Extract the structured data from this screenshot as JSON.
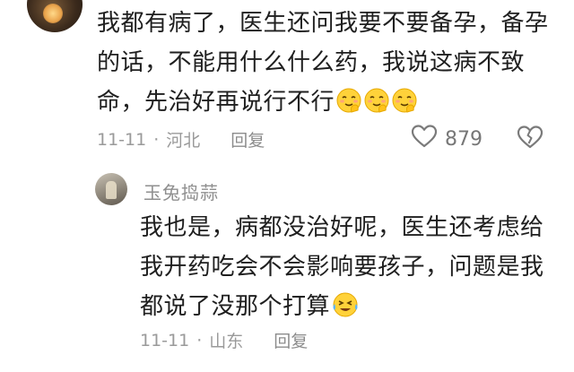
{
  "comment": {
    "text": "我都有病了，医生还问我要不要备孕，备孕的话，不能用什么什么药，我说这病不致命，先治好再说行不行",
    "emoji": [
      "smiling-face-with-hand",
      "smiling-face-with-hand",
      "smiling-face-with-hand"
    ],
    "date": "11-11",
    "separator": "·",
    "location": "河北",
    "reply_label": "回复",
    "like_count": "879"
  },
  "reply": {
    "username": "玉兔捣蒜",
    "text": "我也是，病都没治好呢，医生还考虑给我开药吃会不会影响要孩子，问题是我都说了没那个打算",
    "emoji": [
      "crying-smile-face"
    ],
    "date": "11-11",
    "separator": "·",
    "location": "山东",
    "reply_label": "回复"
  },
  "icons": {
    "like": "heart-outline-icon",
    "dislike": "broken-heart-icon"
  },
  "colors": {
    "text": "#1f1f1f",
    "meta": "#9a9a9a",
    "emoji": "#ffd23a"
  }
}
